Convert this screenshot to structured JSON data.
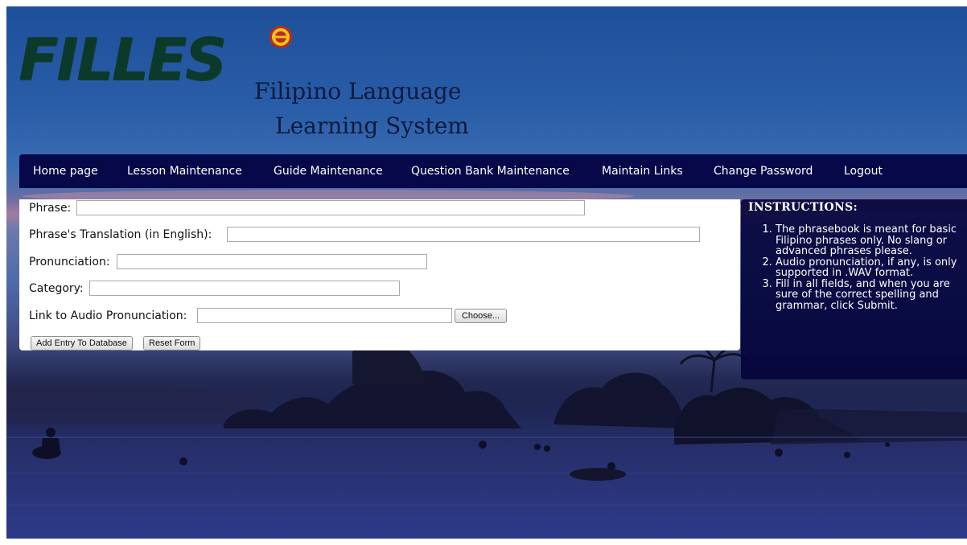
{
  "header": {
    "logo_text": "FILLES",
    "subtitle_line1": "Filipino Language",
    "subtitle_line2": "Learning System"
  },
  "nav": {
    "items": [
      {
        "label": "Home page"
      },
      {
        "label": "Lesson Maintenance"
      },
      {
        "label": "Guide Maintenance"
      },
      {
        "label": "Question Bank Maintenance"
      },
      {
        "label": "Maintain Links"
      },
      {
        "label": "Change Password"
      },
      {
        "label": "Logout"
      }
    ]
  },
  "form": {
    "phrase_label": "Phrase:",
    "phrase_value": "",
    "translation_label": "Phrase's Translation (in English):",
    "translation_value": "",
    "pronunciation_label": "Pronunciation:",
    "pronunciation_value": "",
    "category_label": "Category:",
    "category_value": "",
    "audio_label": "Link to Audio Pronunciation:",
    "audio_value": "",
    "choose_label": "Choose...",
    "add_label": "Add Entry To Database",
    "reset_label": "Reset Form"
  },
  "instructions": {
    "title": "INSTRUCTIONS:",
    "items": [
      "The phrasebook is meant for basic Filipino phrases only. No slang or advanced phrases please.",
      "Audio pronunciation, if any, is only supported in .WAV format.",
      "Fill in all fields, and when you are sure of the correct spelling and grammar, click Submit."
    ]
  },
  "colors": {
    "nav_bg": "#07084a",
    "logo_green": "#0b3a2a",
    "instructions_bg": "#04043c"
  }
}
